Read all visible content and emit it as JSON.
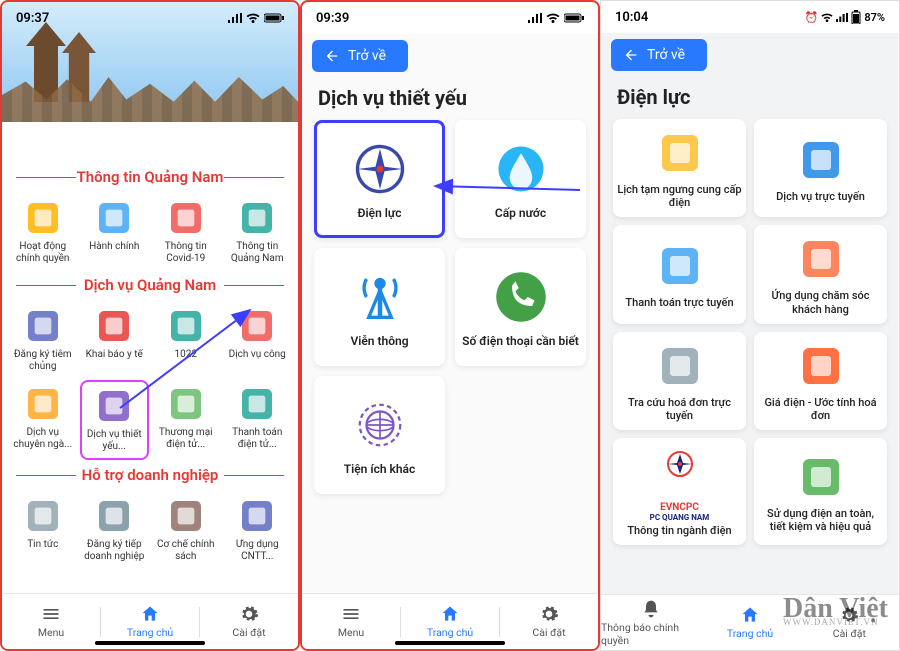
{
  "phone1": {
    "status": {
      "time": "09:37"
    },
    "sections": [
      {
        "title": "Thông tin Quảng Nam",
        "items": [
          {
            "label": "Hoạt động chính quyền",
            "icon": "government-icon",
            "color": "#ffb300"
          },
          {
            "label": "Hành chính",
            "icon": "building-icon",
            "color": "#42a5f5"
          },
          {
            "label": "Thông tin Covid-19",
            "icon": "covid-icon",
            "color": "#ef5350"
          },
          {
            "label": "Thông tin Quảng Nam",
            "icon": "news-screen-icon",
            "color": "#26a69a"
          }
        ]
      },
      {
        "title": "Dịch vụ Quảng Nam",
        "items": [
          {
            "label": "Đăng ký tiêm chủng",
            "icon": "vaccine-icon",
            "color": "#5c6bc0"
          },
          {
            "label": "Khai báo y tế",
            "icon": "medical-declare-icon",
            "color": "#e53935"
          },
          {
            "label": "1022",
            "icon": "notebook-icon",
            "color": "#26a69a"
          },
          {
            "label": "Dịch vụ công",
            "icon": "star-icon",
            "color": "#ef5350"
          },
          {
            "label": "Dịch vụ chuyên ngà...",
            "icon": "gear-dual-icon",
            "color": "#ffa726"
          },
          {
            "label": "Dịch vụ thiết yếu...",
            "icon": "essential-monitor-icon",
            "color": "#7e57c2",
            "highlight": true
          },
          {
            "label": "Thương mại điện tử...",
            "icon": "cart-icon",
            "color": "#66bb6a"
          },
          {
            "label": "Thanh toán điện tử...",
            "icon": "cash-icon",
            "color": "#26a69a"
          }
        ]
      },
      {
        "title": "Hỗ trợ doanh nghiệp",
        "items": [
          {
            "label": "Tin tức",
            "icon": "newspaper-icon",
            "color": "#90a4ae"
          },
          {
            "label": "Đăng ký tiếp doanh nghiệp",
            "icon": "form-icon",
            "color": "#78909c"
          },
          {
            "label": "Cơ chế chính sách",
            "icon": "policy-icon",
            "color": "#8d6e63"
          },
          {
            "label": "Ứng dụng CNTT...",
            "icon": "app-screen-icon",
            "color": "#5c6bc0"
          }
        ]
      }
    ],
    "bottom": {
      "items": [
        {
          "label": "Menu",
          "icon": "menu-icon"
        },
        {
          "label": "Trang chủ",
          "icon": "home-icon",
          "active": true
        },
        {
          "label": "Cài đặt",
          "icon": "gear-icon"
        }
      ]
    }
  },
  "phone2": {
    "status": {
      "time": "09:39"
    },
    "back": "Trở về",
    "title": "Dịch vụ thiết yếu",
    "cards": [
      {
        "label": "Điện lực",
        "icon": "evn-icon",
        "color": "#3949ab",
        "highlight": true
      },
      {
        "label": "Cấp nước",
        "icon": "water-drop-icon",
        "color": "#29b6f6"
      },
      {
        "label": "Viễn thông",
        "icon": "antenna-icon",
        "color": "#1e88e5"
      },
      {
        "label": "Số điện thoại cần biết",
        "icon": "phone-icon",
        "color": "#43a047"
      },
      {
        "label": "Tiện ích khác",
        "icon": "globe-gear-icon",
        "color": "#7e57c2"
      }
    ],
    "bottom": {
      "items": [
        {
          "label": "Menu",
          "icon": "menu-icon"
        },
        {
          "label": "Trang chủ",
          "icon": "home-icon",
          "active": true
        },
        {
          "label": "Cài đặt",
          "icon": "gear-icon"
        }
      ]
    }
  },
  "phone3": {
    "status": {
      "time": "10:04",
      "battery": "87%"
    },
    "back": "Trở về",
    "title": "Điện lực",
    "cards": [
      {
        "label": "Lịch tạm ngưng cung cấp điện",
        "icon": "plug-schedule-icon",
        "color": "#fbc02d"
      },
      {
        "label": "Dịch vụ trực tuyến",
        "icon": "online-service-icon",
        "color": "#1e88e5"
      },
      {
        "label": "Thanh toán trực tuyến",
        "icon": "pay-online-icon",
        "color": "#42a5f5"
      },
      {
        "label": "Ứng dụng chăm sóc khách hàng",
        "icon": "apps-grid-icon",
        "color": "#ff7043"
      },
      {
        "label": "Tra cứu hoá đơn trực tuyến",
        "icon": "invoice-search-icon",
        "color": "#90a4ae"
      },
      {
        "label": "Giá điện - Ước tính hoá đơn",
        "icon": "price-estimate-icon",
        "color": "#ff5722"
      },
      {
        "label": "Thông tin ngành điện",
        "icon": "evn-cpc-icon",
        "color": "#e53935",
        "extra": "EVNCPC",
        "extra2": "PC QUANG NAM"
      },
      {
        "label": "Sử dụng điện an toàn, tiết kiệm và hiệu quả",
        "icon": "eco-bulb-icon",
        "color": "#4caf50"
      }
    ],
    "bottom": {
      "items": [
        {
          "label": "Thông báo chính quyền",
          "icon": "bell-icon"
        },
        {
          "label": "Trang chủ",
          "icon": "home-icon",
          "active": true
        },
        {
          "label": "Cài đặt",
          "icon": "gear-icon"
        }
      ]
    }
  },
  "watermark": {
    "main": "Dân Việt",
    "sub": "WWW.DANVIET.VN"
  }
}
